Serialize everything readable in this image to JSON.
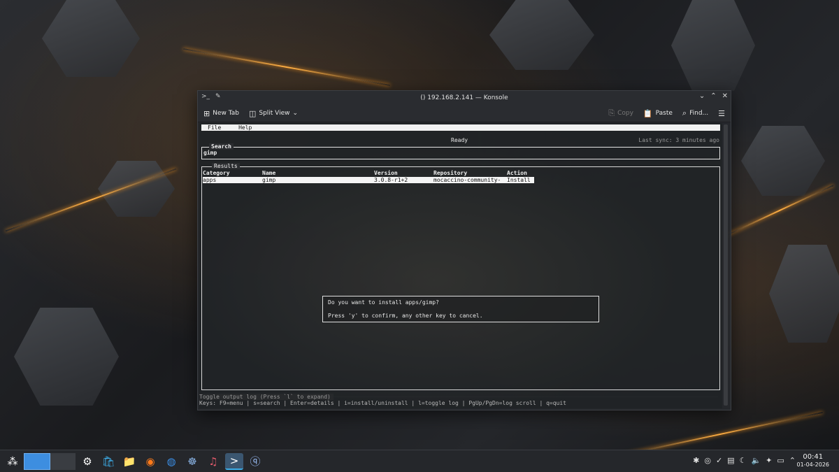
{
  "window": {
    "title": "() 192.168.2.141 — Konsole",
    "titlebar_left_icons": [
      "terminal-icon",
      "pin-icon"
    ],
    "controls": [
      "minimize",
      "maximize",
      "close"
    ]
  },
  "toolbar": {
    "new_tab": "New Tab",
    "split_view": "Split View",
    "copy": "Copy",
    "paste": "Paste",
    "find": "Find..."
  },
  "terminal": {
    "menu": {
      "file": "File",
      "help": "Help"
    },
    "status": "Ready",
    "last_sync": "Last sync: 3 minutes ago",
    "search": {
      "label": "Search",
      "value": "gimp"
    },
    "results": {
      "label": "Results",
      "headers": [
        "Category",
        "Name",
        "Version",
        "Repository",
        "Action"
      ],
      "rows": [
        [
          "apps",
          "gimp",
          "3.0.8-r1+2",
          "mocaccino-community-",
          "Install"
        ]
      ]
    },
    "dialog": {
      "question": "Do you want to install apps/gimp?",
      "hint": "Press 'y' to confirm, any other key to cancel."
    },
    "log_toggle": "Toggle output log (Press `l` to expand)",
    "keys": "Keys: F9=menu | s=search | Enter=details | i=install/uninstall | l=toggle log | PgUp/PgDn=log scroll | q=quit"
  },
  "taskbar": {
    "apps": [
      "app-launcher-icon",
      "pager-desktop-1",
      "pager-desktop-2",
      "system-settings-icon",
      "discover-icon",
      "files-icon",
      "firefox-icon",
      "thunderbird-icon",
      "kde-connect-icon",
      "clementine-icon",
      "konsole-icon",
      "qbittorrent-icon"
    ],
    "clock": {
      "time": "00:41",
      "date": "01-04-2026"
    }
  },
  "colors": {
    "accent": "#3daee9",
    "window_bg": "#2a2c30",
    "selection_bg": "#f4f4f4"
  }
}
